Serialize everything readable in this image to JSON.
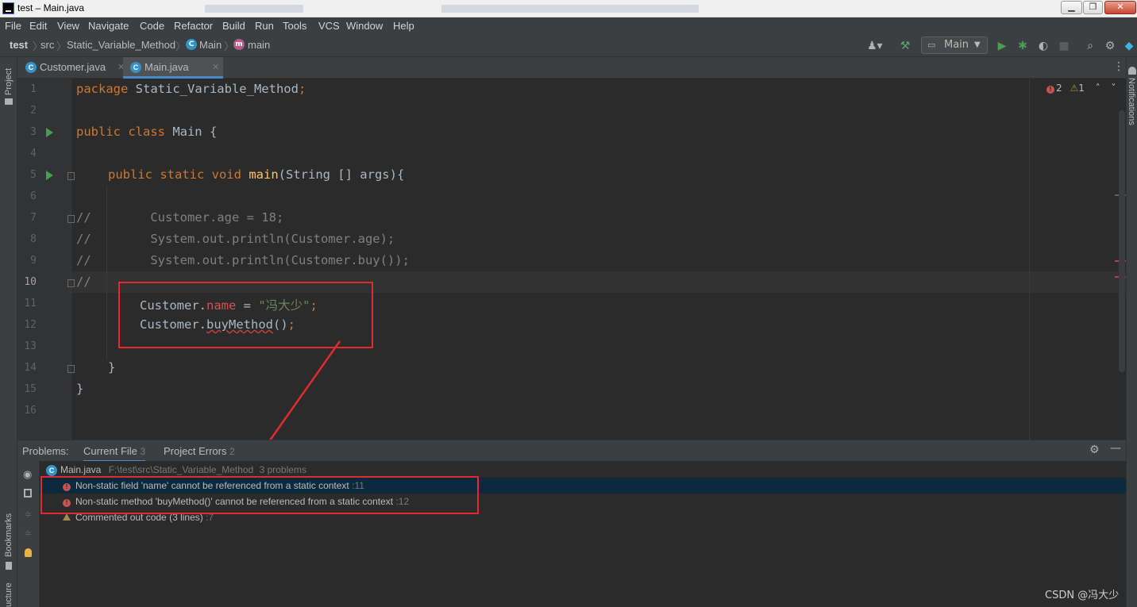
{
  "window": {
    "title": "test – Main.java",
    "buttons": {
      "minimize": "▁",
      "maximize": "❐",
      "close": "✕"
    }
  },
  "menu": [
    "File",
    "Edit",
    "View",
    "Navigate",
    "Code",
    "Refactor",
    "Build",
    "Run",
    "Tools",
    "VCS",
    "Window",
    "Help"
  ],
  "breadcrumb": {
    "project": "test",
    "src": "src",
    "package": "Static_Variable_Method",
    "class": "Main",
    "method": "main"
  },
  "toolbar": {
    "run_config": "Main",
    "icons": [
      "user-icon",
      "build-hammer-icon",
      "run-icon",
      "debug-icon",
      "coverage-icon",
      "stop-icon",
      "search-icon",
      "settings-icon",
      "plugin-icon"
    ]
  },
  "tool_windows": {
    "left_top": "Project",
    "left_bottom": "Bookmarks",
    "left_bottom2": "ucture",
    "right": "Notifications"
  },
  "tabs": [
    {
      "label": "Customer.java",
      "active": false
    },
    {
      "label": "Main.java",
      "active": true
    }
  ],
  "editor": {
    "line_numbers": [
      "1",
      "2",
      "3",
      "4",
      "5",
      "6",
      "7",
      "8",
      "9",
      "10",
      "11",
      "12",
      "13",
      "14",
      "15",
      "16"
    ],
    "current_line": "10",
    "code": {
      "l1_kw": "package",
      "l1_rest": " Static_Variable_Method",
      "l1_semi": ";",
      "l3_kw": "public class",
      "l3_rest": " Main {",
      "l5_kw": "public static void",
      "l5_fn": "main",
      "l5_rest": "(String [] args){",
      "l7": "//        Customer.age = 18;",
      "l8": "//        System.out.println(Customer.age);",
      "l9": "//        System.out.println(Customer.buy());",
      "l10": "//",
      "l11_a": "Customer.",
      "l11_field": "name",
      "l11_b": " = ",
      "l11_str": "\"冯大少\"",
      "l11_semi": ";",
      "l12_a": "Customer.",
      "l12_method": "buyMethod",
      "l12_b": "()",
      "l12_semi": ";",
      "l14": "}",
      "l15": "}"
    },
    "inspection": {
      "errors": "2",
      "warnings": "1"
    }
  },
  "problems": {
    "label": "Problems:",
    "tabs": [
      {
        "label": "Current File",
        "count": "3",
        "active": true
      },
      {
        "label": "Project Errors",
        "count": "2",
        "active": false
      }
    ],
    "file": {
      "name": "Main.java",
      "path": "F:\\test\\src\\Static_Variable_Method",
      "summary": "3 problems"
    },
    "items": [
      {
        "type": "error",
        "message": "Non-static field 'name' cannot be referenced from a static context",
        "line": ":11"
      },
      {
        "type": "error",
        "message": "Non-static method 'buyMethod()' cannot be referenced from a static context",
        "line": ":12"
      },
      {
        "type": "warning",
        "message": "Commented out code (3 lines)",
        "line": ":7"
      }
    ]
  },
  "watermark": "CSDN @冯大少"
}
